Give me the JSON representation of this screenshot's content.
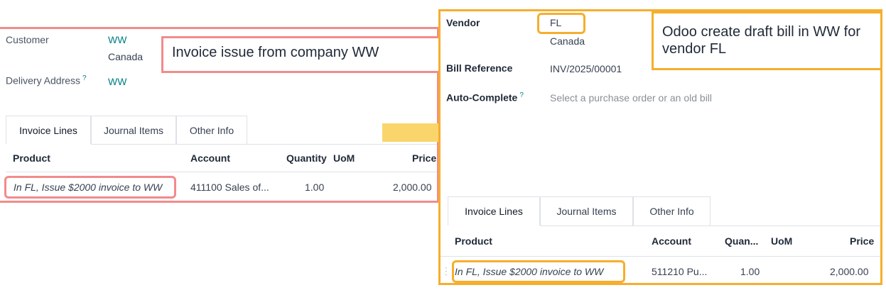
{
  "left": {
    "customer_label": "Customer",
    "customer_name": "WW",
    "customer_country": "Canada",
    "delivery_label": "Delivery Address",
    "delivery_help": "?",
    "delivery_value": "WW",
    "annotation": "Invoice issue from company WW",
    "tabs": [
      {
        "label": "Invoice Lines",
        "active": true
      },
      {
        "label": "Journal Items",
        "active": false
      },
      {
        "label": "Other Info",
        "active": false
      }
    ],
    "columns": {
      "product": "Product",
      "account": "Account",
      "quantity": "Quantity",
      "uom": "UoM",
      "price": "Price"
    },
    "row": {
      "product": "In FL, Issue $2000 invoice to WW",
      "account": "411100 Sales of...",
      "quantity": "1.00",
      "uom": "",
      "price": "2,000.00"
    }
  },
  "right": {
    "vendor_label": "Vendor",
    "vendor_name": "FL",
    "vendor_country": "Canada",
    "bill_ref_label": "Bill Reference",
    "bill_ref_value": "INV/2025/00001",
    "autocomplete_label": "Auto-Complete",
    "autocomplete_help": "?",
    "autocomplete_placeholder": "Select a purchase order or an old bill",
    "annotation": "Odoo create draft bill in WW for vendor FL",
    "tabs": [
      {
        "label": "Invoice Lines",
        "active": true
      },
      {
        "label": "Journal Items",
        "active": false
      },
      {
        "label": "Other Info",
        "active": false
      }
    ],
    "columns": {
      "product": "Product",
      "account": "Account",
      "quantity": "Quan...",
      "uom": "UoM",
      "price": "Price"
    },
    "row": {
      "handle": "⋮",
      "product": "In FL, Issue $2000 invoice to WW",
      "account": "511210 Pu...",
      "quantity": "1.00",
      "uom": "",
      "price": "2,000.00"
    }
  },
  "colors": {
    "red_highlight": "#f28b8b",
    "orange_highlight": "#f6ae2d",
    "arrow": "#f9d56b",
    "link": "#017e84"
  }
}
